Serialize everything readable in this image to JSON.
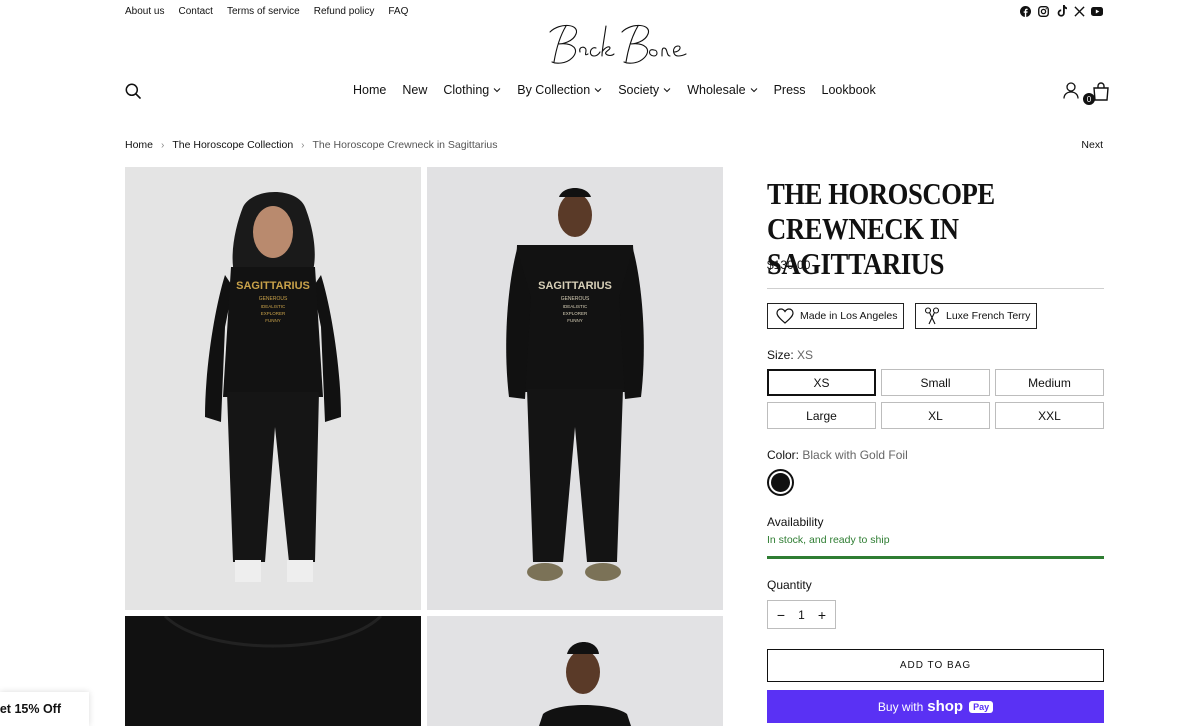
{
  "utility_links": [
    "About us",
    "Contact",
    "Terms of service",
    "Refund policy",
    "FAQ"
  ],
  "social_icons": [
    "facebook-icon",
    "instagram-icon",
    "tiktok-icon",
    "x-icon",
    "youtube-icon"
  ],
  "logo_text": "BackBone",
  "nav": {
    "home": "Home",
    "new": "New",
    "clothing": "Clothing",
    "by_collection": "By Collection",
    "society": "Society",
    "wholesale": "Wholesale",
    "press": "Press",
    "lookbook": "Lookbook"
  },
  "bag_count": "0",
  "breadcrumb": {
    "home": "Home",
    "collection": "The Horoscope Collection",
    "current": "The Horoscope Crewneck in Sagittarius",
    "next": "Next"
  },
  "gallery": {
    "front_text": "SAGITTARIUS",
    "traits": [
      "GENEROUS",
      "IDEALISTIC",
      "EXPLORER",
      "FUNNY"
    ]
  },
  "product": {
    "title": "The Horoscope Crewneck in Sagittarius",
    "price": "$130.00",
    "features": [
      "Made in Los Angeles",
      "Luxe French Terry"
    ],
    "size_label": "Size:",
    "size_value": "XS",
    "sizes": [
      "XS",
      "Small",
      "Medium",
      "Large",
      "XL",
      "XXL"
    ],
    "selected_size": "XS",
    "color_label": "Color:",
    "color_value": "Black with Gold Foil",
    "swatch_color": "#111111",
    "availability_label": "Availability",
    "availability_status": "In stock, and ready to ship",
    "quantity_label": "Quantity",
    "quantity": "1",
    "add_to_bag": "ADD TO BAG",
    "buy_with": "Buy with",
    "shop_brand": "shop",
    "shop_pay": "Pay"
  },
  "promo": "et 15% Off",
  "colors": {
    "accent": "#5a31f4",
    "stock": "#2e7d32"
  }
}
